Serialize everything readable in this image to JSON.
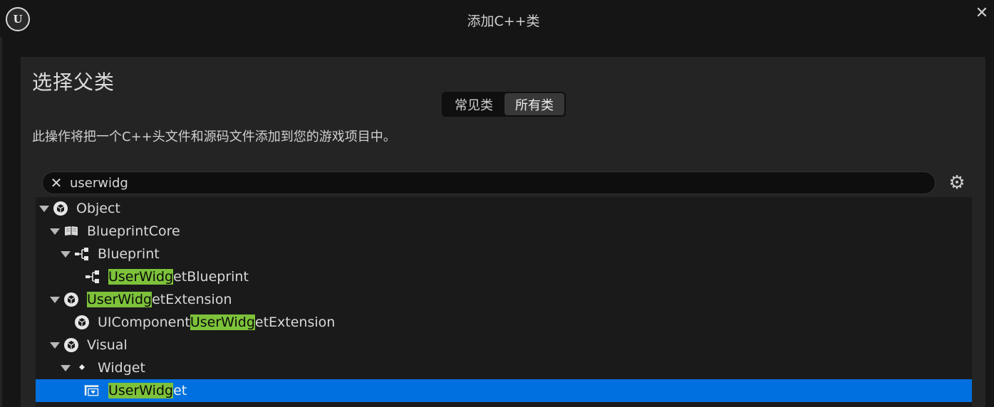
{
  "window": {
    "logo_text": "U",
    "title": "添加C++类",
    "close_glyph": "✕"
  },
  "dialog": {
    "heading": "选择父类",
    "tabs": [
      {
        "label": "常见类",
        "active": false
      },
      {
        "label": "所有类",
        "active": true
      }
    ],
    "description": "此操作将把一个C++头文件和源码文件添加到您的游戏项目中。"
  },
  "search": {
    "clear_glyph": "✕",
    "value": "userwidg",
    "settings_icon": "gear-icon"
  },
  "colors": {
    "highlight": "#7dc23a",
    "selection": "#0070e0"
  },
  "tree": [
    {
      "pre": "Object",
      "match": "",
      "post": "",
      "icon": "class-icon",
      "expanded": true,
      "selected": false
    },
    {
      "pre": "BlueprintCore",
      "match": "",
      "post": "",
      "icon": "book-icon",
      "expanded": true,
      "selected": false
    },
    {
      "pre": "Blueprint",
      "match": "",
      "post": "",
      "icon": "blueprint-icon",
      "expanded": true,
      "selected": false
    },
    {
      "pre": "",
      "match": "UserWidg",
      "post": "etBlueprint",
      "icon": "blueprint-icon",
      "expanded": false,
      "selected": false
    },
    {
      "pre": "",
      "match": "UserWidg",
      "post": "etExtension",
      "icon": "class-icon",
      "expanded": true,
      "selected": false
    },
    {
      "pre": "UIComponent",
      "match": "UserWidg",
      "post": "etExtension",
      "icon": "class-icon",
      "expanded": false,
      "selected": false
    },
    {
      "pre": "Visual",
      "match": "",
      "post": "",
      "icon": "class-icon",
      "expanded": true,
      "selected": false
    },
    {
      "pre": "Widget",
      "match": "",
      "post": "",
      "icon": "diamond-icon",
      "expanded": true,
      "selected": false
    },
    {
      "pre": "",
      "match": "UserWidg",
      "post": "et",
      "icon": "user-widget-icon",
      "expanded": false,
      "selected": true
    }
  ]
}
